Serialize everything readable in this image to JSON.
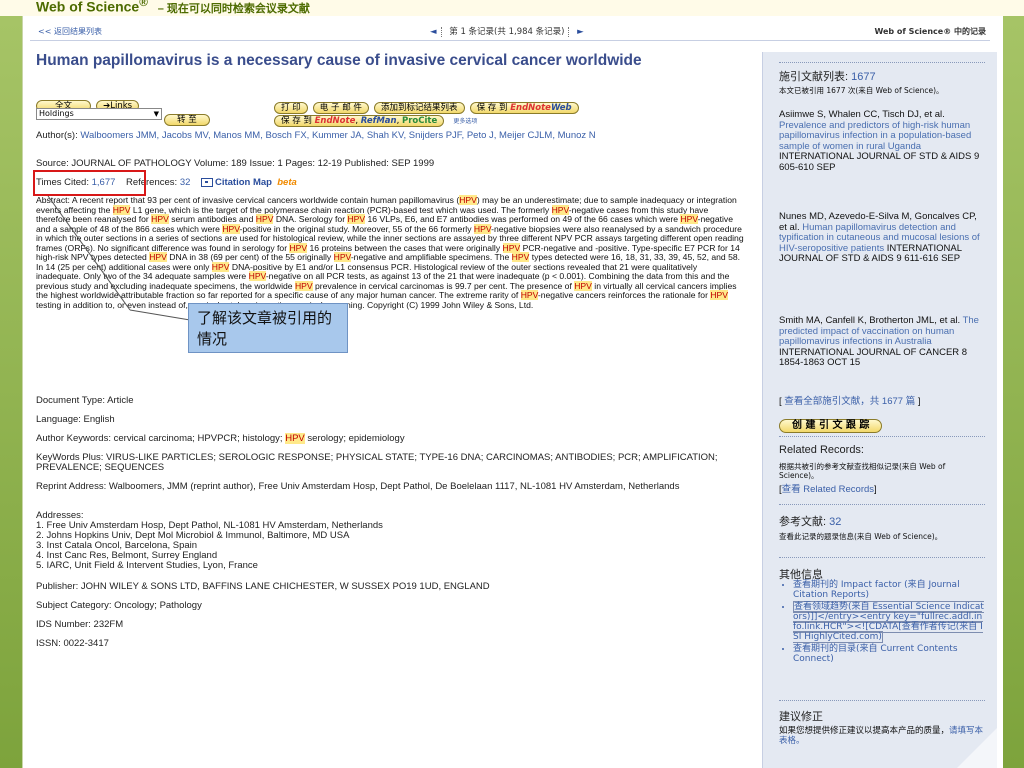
{
  "header": {
    "brand": "Web of Science",
    "reg": "®",
    "subtitle": "– 现在可以同时检索会议录文献"
  },
  "nav": {
    "back": "<< 返回结果列表",
    "prev_arrow": "◄",
    "record_position": "第 1 条记录(共 1,984 条记录)",
    "next_arrow": "►",
    "source_label": "Web of Science® 中的记录"
  },
  "article": {
    "title": "Human papillomavirus is a necessary cause of invasive cervical cancer worldwide",
    "buttons": {
      "fulltext": "全文",
      "links": "➔Links",
      "print": "打 印",
      "email": "电 子 邮 件",
      "add_marked": "添加到标记结果列表",
      "save_to": "保 存 到",
      "save_to_2": "保 存 到",
      "endnote": "EndNote",
      "web": "Web",
      "endnote2": "EndNote",
      "refman": "RefMan",
      "procite": "ProCite",
      "more_options": "更多选项",
      "goto": "转 至"
    },
    "holdings_select": "Holdings",
    "authors_label": "Author(s):",
    "authors": "Walboomers JMM, Jacobs MV, Manos MM, Bosch FX, Kummer JA, Shah KV, Snijders PJF, Peto J, Meijer CJLM, Munoz N",
    "source_line": "Source: JOURNAL OF PATHOLOGY    Volume: 189    Issue: 1    Pages: 12-19    Published: SEP 1999",
    "times_cited_label": "Times Cited:",
    "times_cited": "1,677",
    "references_label": "References:",
    "references": "32",
    "citation_map": "Citation Map",
    "beta": "beta",
    "abstract_parts": [
      "Abstract: A recent report that 93 per cent of invasive cervical cancers worldwide contain human papillomavirus (",
      "HPV",
      ") may be an underestimate; due to sample inadequacy or integration events affecting the ",
      "HPV",
      " L1 gene, which is the target of the polymerase chain reaction (PCR)-based test which was used. The formerly ",
      "HPV",
      "-negative cases from this study have therefore been reanalysed for ",
      "HPV",
      " serum antibodies and ",
      "HPV",
      " DNA. Serology for ",
      "HPV",
      " 16 VLPs, E6, and E7 antibodies was performed on 49 of the 66 cases which were ",
      "HPV",
      "-negative and a sample of 48 of the 866 cases which were ",
      "HPV",
      "-positive in the original study. Moreover, 55 of the 66 formerly ",
      "HPV",
      "-negative biopsies were also reanalysed by a sandwich procedure in which the outer sections in a series of sections are used for histological review, while the inner sections are assayed by three different NPV PCR assays targeting different open reading frames (ORFs). No significant difference was found in serology for ",
      "HPV",
      " 16 proteins between the cases that were originally ",
      "HPV",
      " PCR-negative and -positive. Type-specific E7 PCR for 14 high-risk NPV types detected ",
      "HPV",
      " DNA in 38 (69 per cent) of the 55 originally ",
      "HPV",
      "-negative and amplifiable specimens. The ",
      "HPV",
      " types detected were 16, 18, 31, 33, 39, 45, 52, and 58. In 14 (25 per cent) additional cases were only ",
      "HPV",
      " DNA-positive by E1 and/or L1 consensus PCR. Histological review of the outer sections revealed that 21 were qualitatively inadequate. Only two of the 34 adequate samples were ",
      "HPV",
      "-negative on all PCR tests, as against 13 of the 21 that were inadequate (p < 0.001). Combining the data from this and the previous study and excluding inadequate specimens, the worldwide ",
      "HPV",
      " prevalence in cervical carcinomas is 99.7 per cent. The presence of ",
      "HPV",
      " in virtually all cervical cancers implies the highest worldwide attributable fraction so far reported for a specific cause of any major human cancer. The extreme rarity of ",
      "HPV",
      "-negative cancers reinforces the rationale for ",
      "HPV",
      " testing in addition to, or even instead of, cervical cytology in routine cervical screening. Copyright (C) 1999 John Wiley & Sons, Ltd."
    ],
    "document_type": "Document Type: Article",
    "language": "Language: English",
    "author_keywords_pre": "Author Keywords: cervical carcinoma; HPVPCR; histology; ",
    "author_keywords_hl": "HPV",
    "author_keywords_post": " serology; epidemiology",
    "keywords_plus": "KeyWords Plus: VIRUS-LIKE PARTICLES; SEROLOGIC RESPONSE; PHYSICAL STATE; TYPE-16 DNA; CARCINOMAS; ANTIBODIES; PCR; AMPLIFICATION; PREVALENCE; SEQUENCES",
    "reprint_address": "Reprint Address: Walboomers, JMM (reprint author), Free Univ Amsterdam Hosp, Dept Pathol, De Boelelaan 1117, NL-1081 HV Amsterdam, Netherlands",
    "addresses_label": "Addresses:",
    "addresses": [
      "1. Free Univ Amsterdam Hosp, Dept Pathol, NL-1081 HV Amsterdam, Netherlands",
      "2. Johns Hopkins Univ, Dept Mol Microbiol & Immunol, Baltimore, MD USA",
      "3. Inst Catala Oncol, Barcelona, Spain",
      "4. Inst Canc Res, Belmont, Surrey England",
      "5. IARC, Unit Field & Intervent Studies, Lyon, France"
    ],
    "publisher": "Publisher: JOHN WILEY & SONS LTD, BAFFINS LANE CHICHESTER, W SUSSEX PO19 1UD, ENGLAND",
    "subject_category": "Subject Category: Oncology; Pathology",
    "ids_number": "IDS Number: 232FM",
    "issn": "ISSN: 0022-3417"
  },
  "callout": {
    "text": "了解该文章被引用的情况"
  },
  "sidebar": {
    "cited_head": "施引文献列表:",
    "cited_count": "1677",
    "cited_note": "本文已被引用 1677 次(来自 Web of Science)。",
    "citing": [
      {
        "authors": "Asiimwe S, Whalen CC, Tisch DJ, et al.",
        "title": "Prevalence and predictors of high-risk human papillomavirus infection in a population-based sample of women in rural Uganda",
        "source": "INTERNATIONAL JOURNAL OF STD & AIDS  9  605-610  SEP"
      },
      {
        "authors": "Nunes MD, Azevedo-E-Silva M, Goncalves CP, et al.",
        "title": "Human papillomavirus detection and typification in cutaneous and mucosal lesions of HIV-seropositive patients",
        "source": "INTERNATIONAL JOURNAL OF STD & AIDS  9  611-616  SEP"
      },
      {
        "authors": "Smith MA, Canfell K, Brotherton JML, et al.",
        "title": "The predicted impact of vaccination on human papillomavirus infections in Australia",
        "source": "INTERNATIONAL JOURNAL OF CANCER  8  1854-1863  OCT 15"
      }
    ],
    "view_all": "查看全部施引文献，共 1677 篇",
    "create_alert": "创 建 引 文 跟 踪",
    "related_head": "Related Records:",
    "related_note": "根据共被引的参考文献查找相似记录(来自 Web of Science)。",
    "related_link": "查看 Related Records",
    "refs_head": "参考文献:",
    "refs_count": "32",
    "refs_note": "查看此记录的题录信息(来自 Web of Science)。",
    "other_head": "其他信息",
    "other_items": [
      "查看期刊的 Impact factor (来自 Journal Citation Reports)",
      "查看领域趋势(来自 Essential Science Indicators)]]</entry><entry key=\"fullrec.addl.info.link.HCR\"><![CDATA[查看作者传记(来自 ISI HighlyCited.com)",
      "查看期刊的目录(来自 Current Contents Connect)"
    ],
    "suggest_head": "建议修正",
    "suggest_text": "如果您想提供修正建议以提高本产品的质量，",
    "suggest_link": "请填写本表格。"
  }
}
